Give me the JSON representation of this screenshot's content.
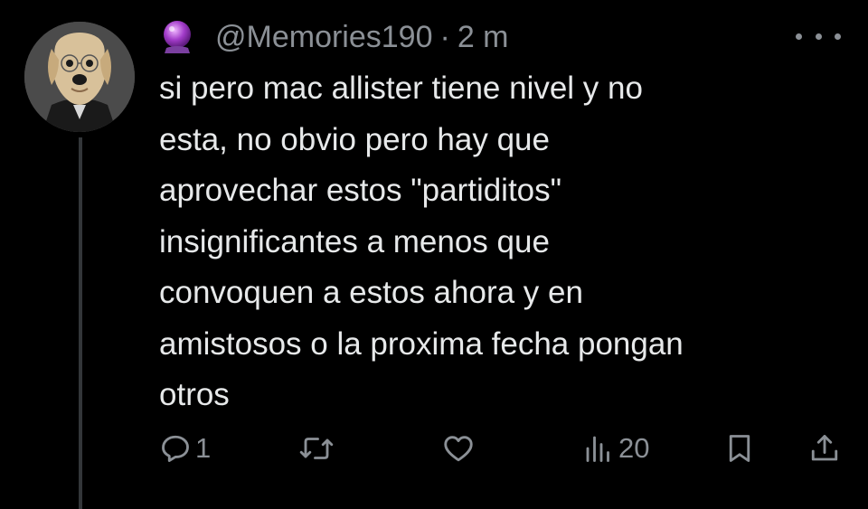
{
  "tweet": {
    "handle": "@Memories190",
    "separator": "·",
    "time": "2 m",
    "avatar": "golden-retriever-in-suit",
    "name_emoji": "crystal-ball",
    "text_lines": [
      "si pero mac allister tiene nivel y no",
      "esta, no obvio pero hay que",
      "aprovechar estos \"partiditos\"",
      "insignificantes a menos que",
      "convoquen a estos ahora y en",
      "amistosos o la proxima fecha pongan",
      "otros"
    ]
  },
  "actions": {
    "reply": {
      "icon": "reply-icon",
      "count": "1"
    },
    "retweet": {
      "icon": "retweet-icon",
      "count": ""
    },
    "like": {
      "icon": "heart-icon",
      "count": ""
    },
    "views": {
      "icon": "views-icon",
      "count": "20"
    },
    "bookmark": {
      "icon": "bookmark-icon"
    },
    "share": {
      "icon": "share-icon"
    }
  },
  "colors": {
    "background": "#000000",
    "text": "#e7e9ea",
    "secondary": "#8b9096",
    "thread_line": "#333639"
  }
}
